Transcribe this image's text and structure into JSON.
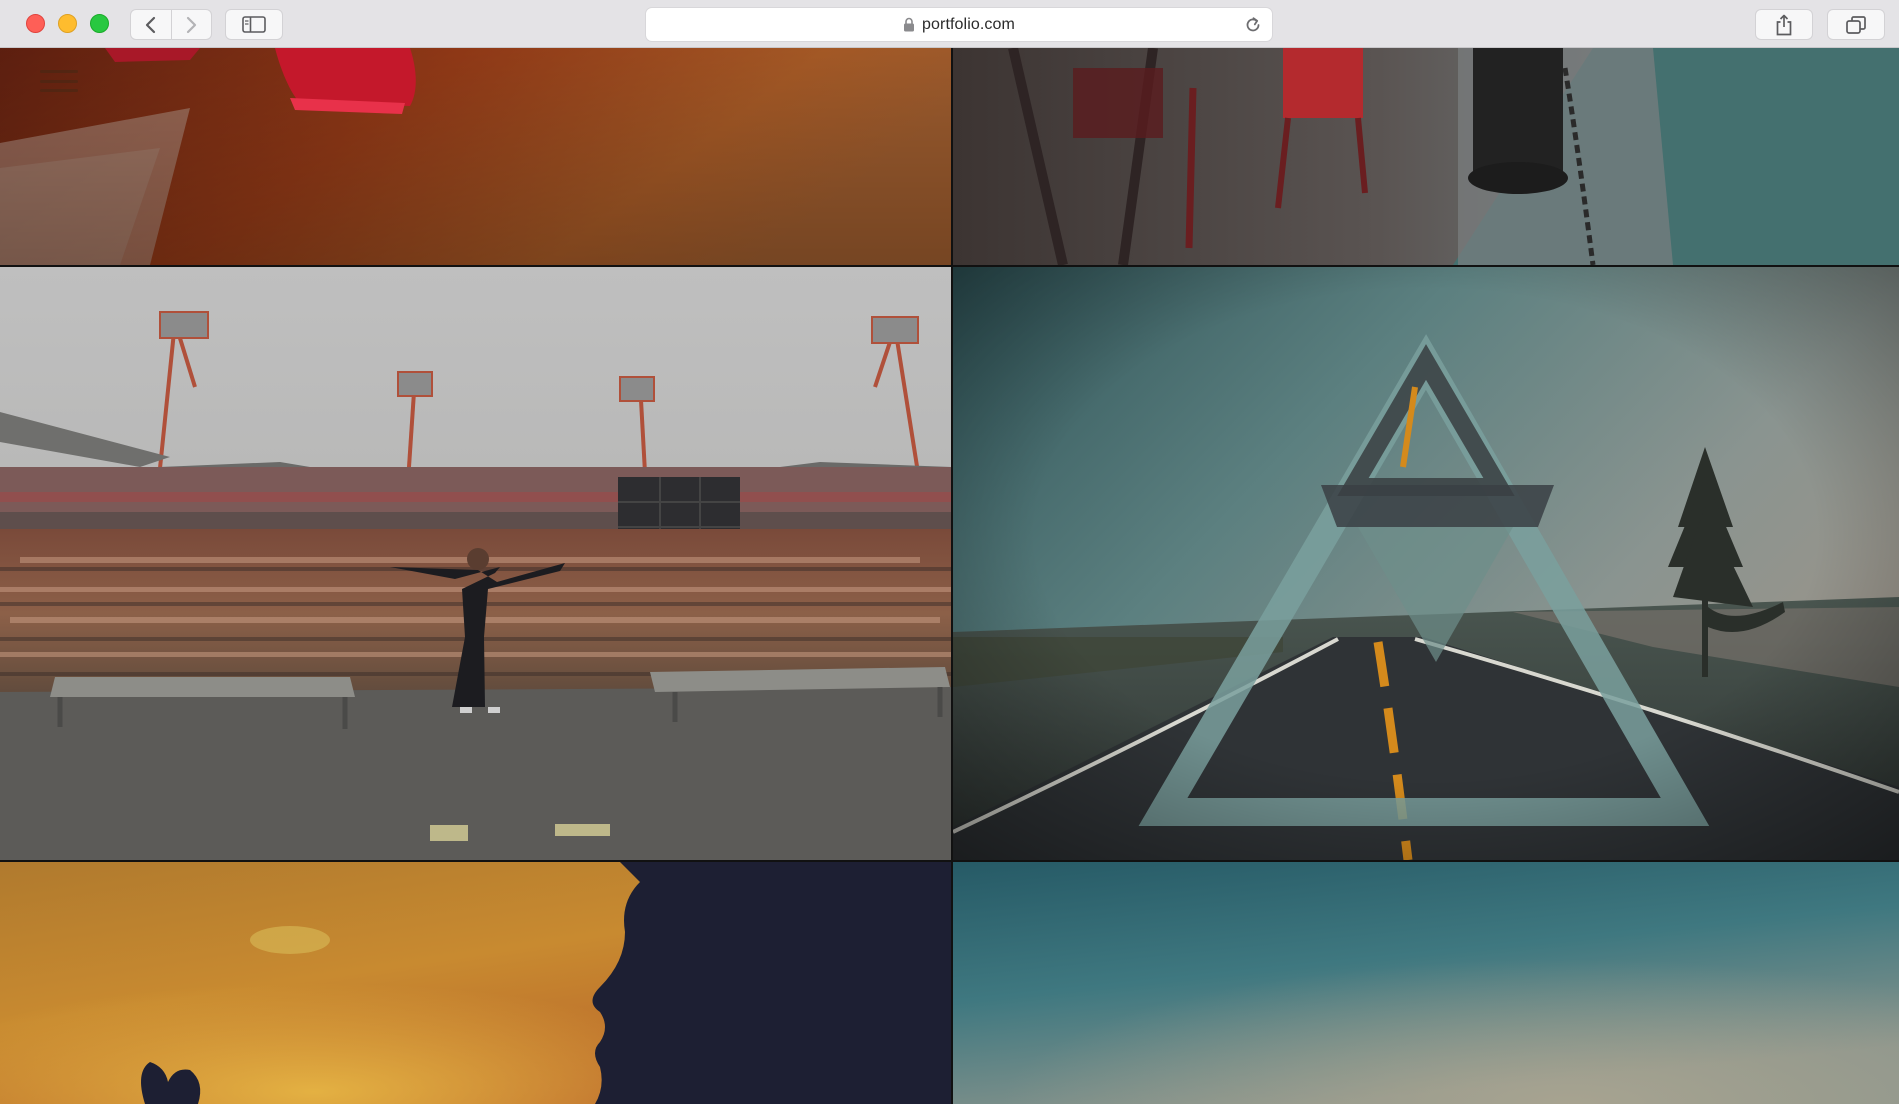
{
  "browser": {
    "url": "portfolio.com",
    "icons": {
      "close": "close-window-icon",
      "minimize": "minimize-window-icon",
      "maximize": "maximize-window-icon",
      "back": "chevron-left-icon",
      "forward": "chevron-right-icon",
      "sidebar": "sidebar-icon",
      "lock": "lock-icon",
      "reload": "reload-icon",
      "share": "share-icon",
      "tabs": "tabs-overview-icon"
    }
  },
  "page": {
    "menu_icon": "hamburger-menu-icon",
    "gallery": [
      {
        "name": "running-track-photo"
      },
      {
        "name": "patio-chairs-photo"
      },
      {
        "name": "stadium-concert-photo"
      },
      {
        "name": "triangle-road-photo"
      },
      {
        "name": "sunset-silhouette-photo"
      },
      {
        "name": "teal-sky-photo"
      }
    ]
  }
}
